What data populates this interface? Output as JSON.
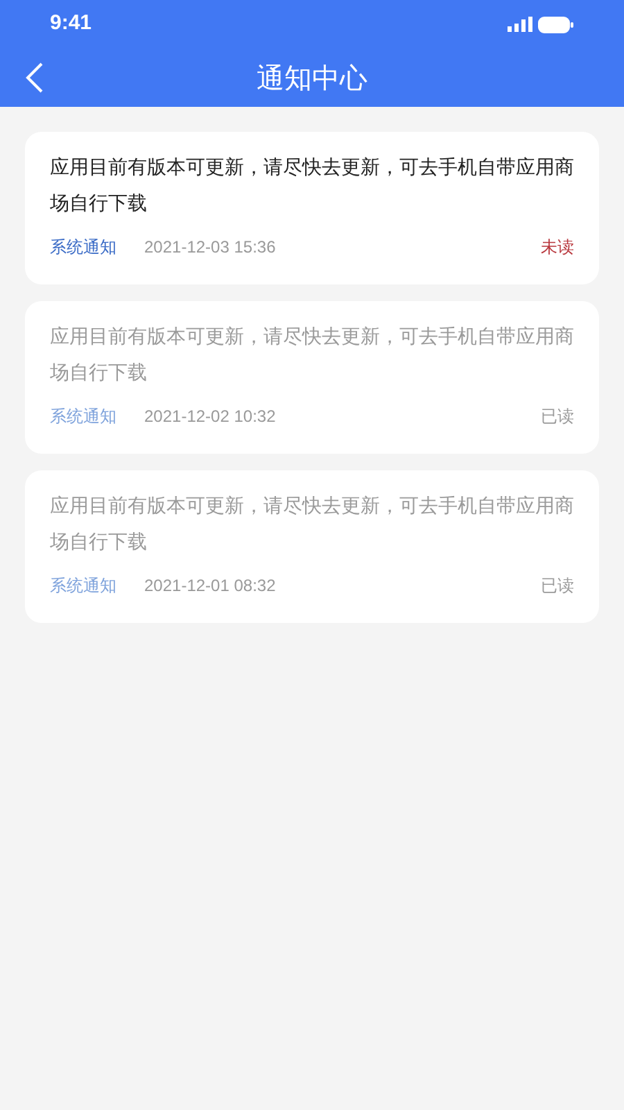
{
  "status_bar": {
    "time": "9:41"
  },
  "header": {
    "title": "通知中心"
  },
  "notifications": [
    {
      "message": "应用目前有版本可更新，请尽快去更新，可去手机自带应用商场自行下载",
      "category": "系统通知",
      "time": "2021-12-03 15:36",
      "status": "未读",
      "read": false
    },
    {
      "message": "应用目前有版本可更新，请尽快去更新，可去手机自带应用商场自行下载",
      "category": "系统通知",
      "time": "2021-12-02 10:32",
      "status": "已读",
      "read": true
    },
    {
      "message": "应用目前有版本可更新，请尽快去更新，可去手机自带应用商场自行下载",
      "category": "系统通知",
      "time": "2021-12-01 08:32",
      "status": "已读",
      "read": true
    }
  ]
}
